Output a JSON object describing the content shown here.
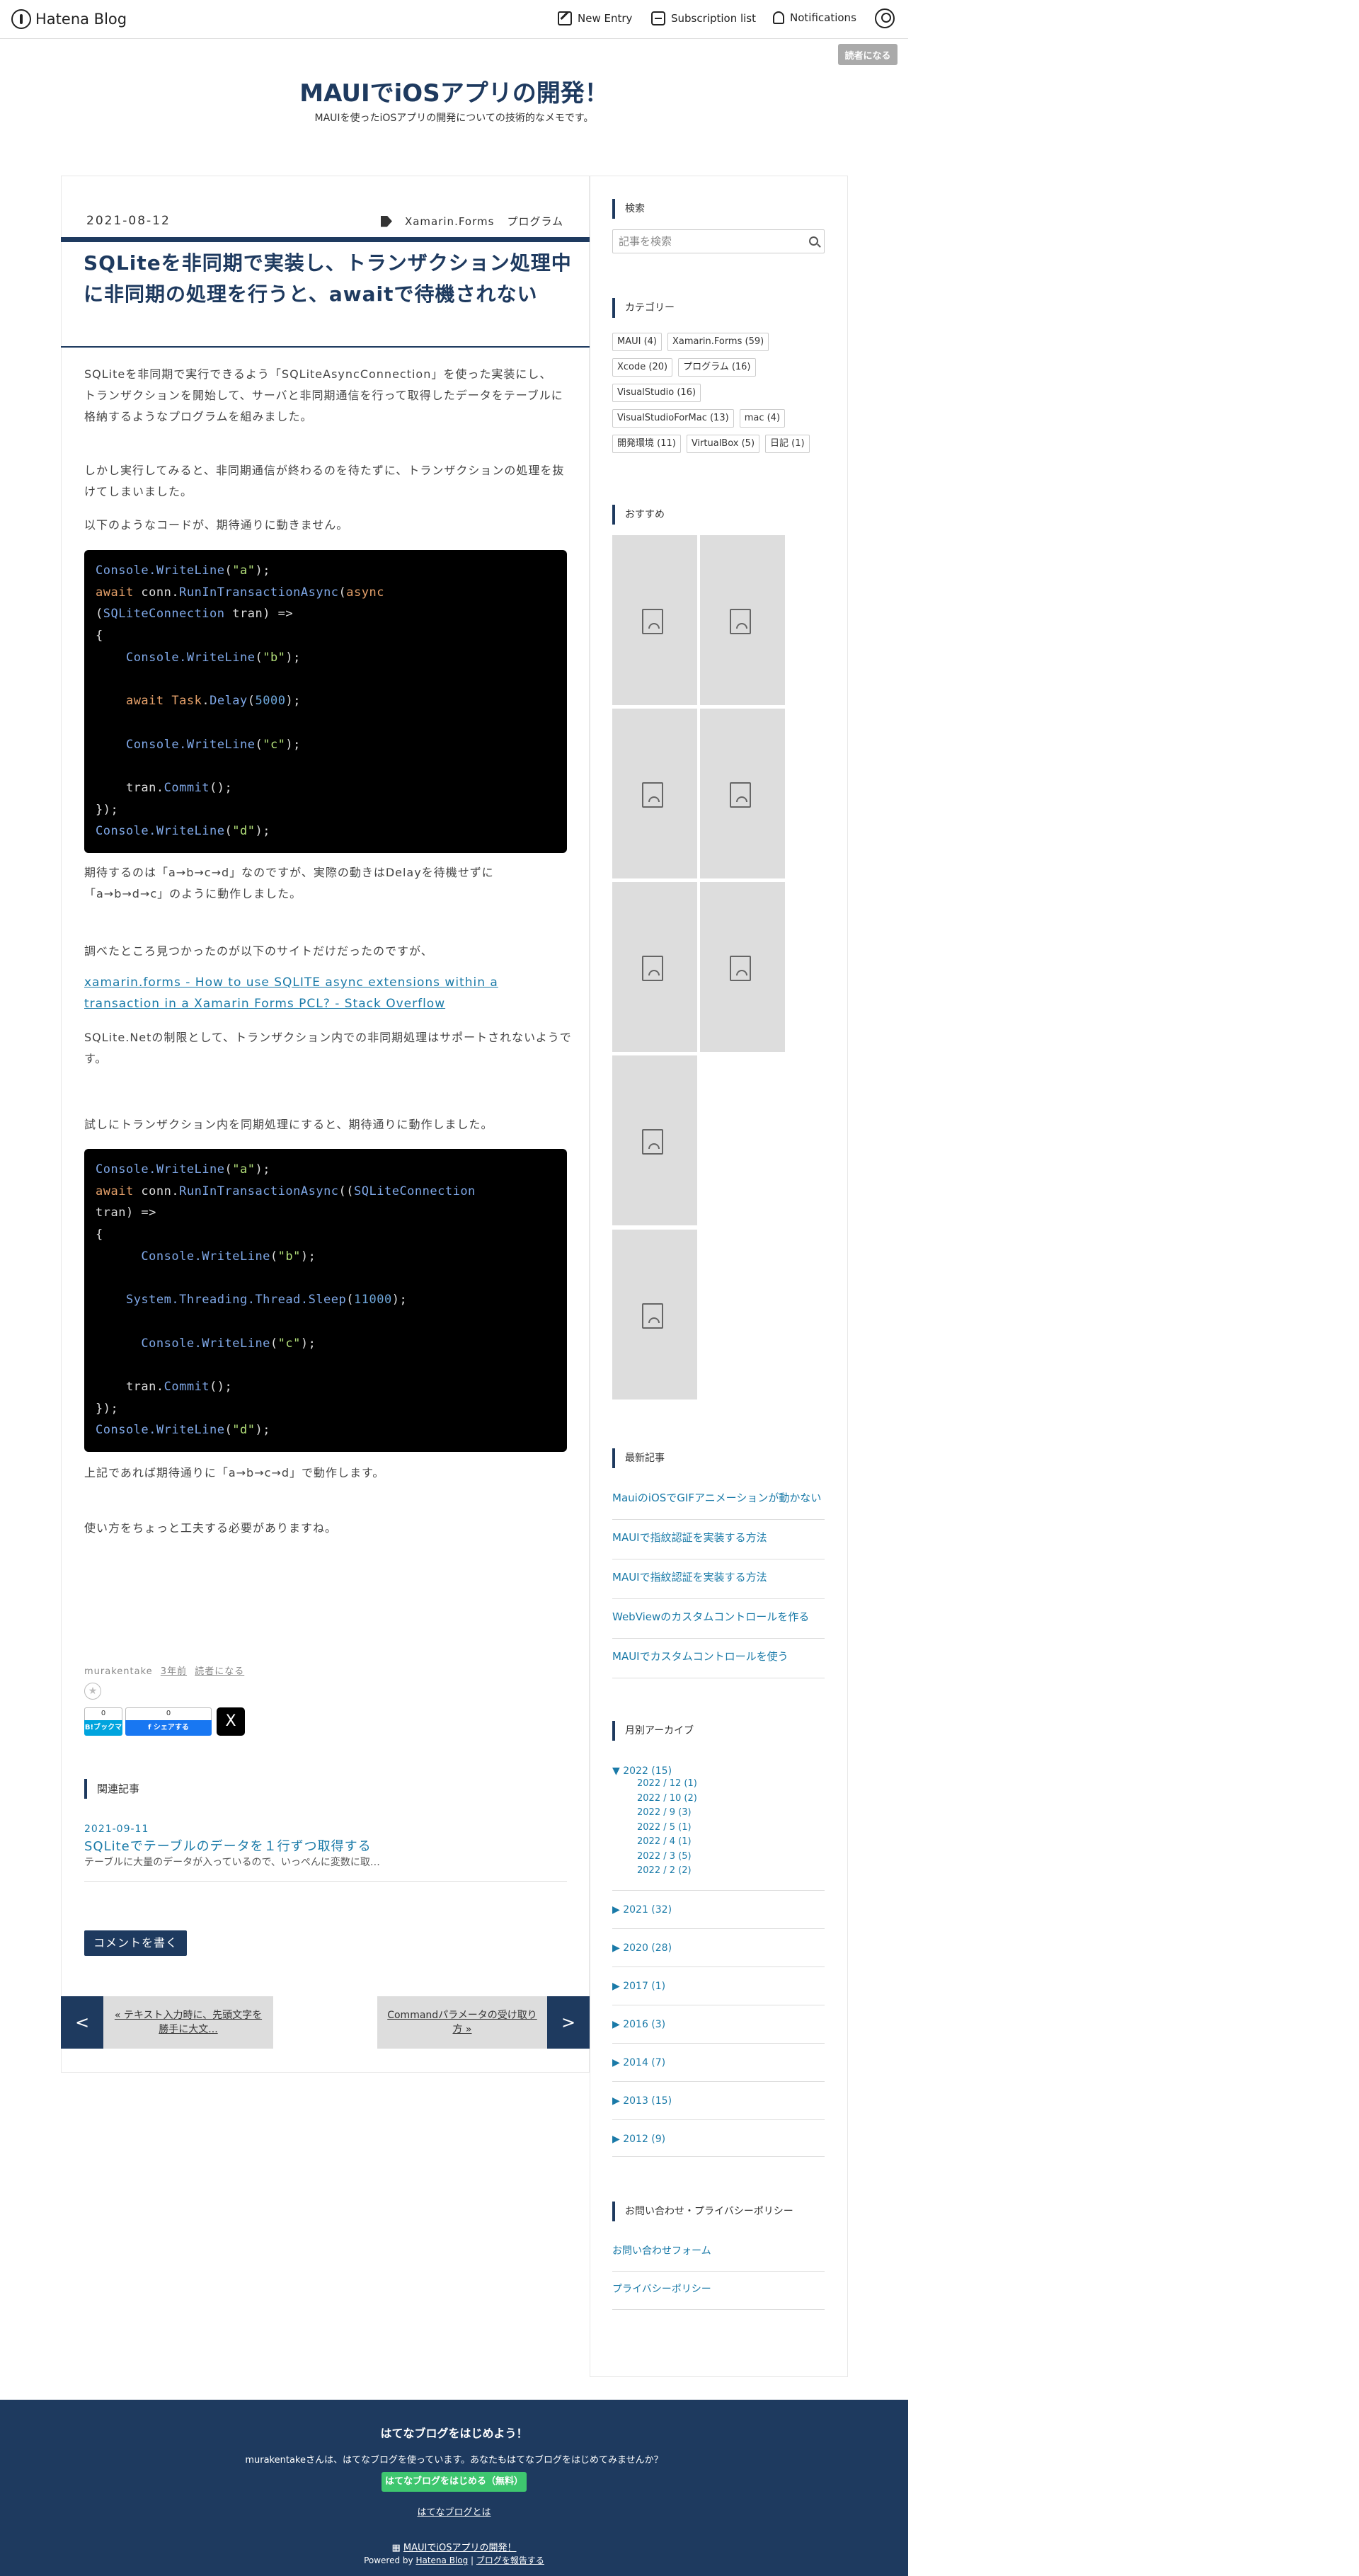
{
  "topbar": {
    "logo": "Hatena Blog",
    "new_entry": "New Entry",
    "subscription": "Subscription list",
    "notifications": "Notifications",
    "follow": "読者になる"
  },
  "blog": {
    "title": "MAUIでiOSアプリの開発！",
    "description": "MAUIを使ったiOSアプリの開発についての技術的なメモです。"
  },
  "entry": {
    "date": "2021-08-12",
    "categories": [
      "Xamarin.Forms",
      "プログラム"
    ],
    "title": "SQLiteを非同期で実装し、トランザクション処理中に非同期の処理を行うと、awaitで待機されない",
    "p1": [
      "SQLiteを非同期で実行できるよう「SQLiteAsyncConnection」を使った実装にし、",
      "トランザクションを開始して、サーバと非同期通信を行って取得したデータをテーブルに格納するようなプログラムを組みました。"
    ],
    "p2": "しかし実行してみると、非同期通信が終わるのを待たずに、トランザクションの処理を抜けてしまいました。",
    "p3": "以下のようなコードが、期待通りに動きません。",
    "p4a": "期待するのは「a→b→c→d」なのですが、実際の動きはDelayを待機せずに",
    "p4b": "「a→b→d→c」のように動作しました。",
    "p5": "調べたところ見つかったのが以下のサイトだけだったのですが、",
    "link": "xamarin.forms - How to use SQLITE async extensions within a transaction in a Xamarin Forms PCL? - Stack Overflow",
    "p6": "SQLite.Netの制限として、トランザクション内での非同期処理はサポートされないようです。",
    "p7": "試しにトランザクション内を同期処理にすると、期待通りに動作しました。",
    "p8": "上記であれば期待通りに「a→b→c→d」で動作します。",
    "p9": "使い方をちょっと工夫する必要がありますね。",
    "author": "murakentake",
    "age": "3年前",
    "follow": "読者になる",
    "hatebu_count": "0",
    "hatebu_label": "B!ブックマーク",
    "fb_count": "0",
    "fb_label": "f シェアする",
    "x_label": "X",
    "related_head": "関連記事",
    "related_date": "2021-09-11",
    "related_title": "SQLiteでテーブルのデータを１行ずつ取得する",
    "related_excerpt": "テーブルに大量のデータが入っているので、いっぺんに変数に取…",
    "comment": "コメントを書く",
    "prev_label": "« テキスト入力時に、先頭文字を勝手に大文...",
    "next_label": "Commandパラメータの受け取り方 »",
    "prev_arrow": "<",
    "next_arrow": ">"
  },
  "code1": [
    [
      [
        "f",
        "Console.WriteLine"
      ],
      [
        "t",
        "("
      ],
      [
        "s",
        "\"a\""
      ],
      [
        "t",
        ");"
      ]
    ],
    [
      [
        "k",
        "await"
      ],
      [
        "t",
        " conn."
      ],
      [
        "f",
        "RunInTransactionAsync"
      ],
      [
        "t",
        "("
      ],
      [
        "k",
        "async"
      ]
    ],
    [
      [
        "t",
        "("
      ],
      [
        "f",
        "SQLiteConnection"
      ],
      [
        "t",
        " tran) =>"
      ]
    ],
    [
      [
        "t",
        "{"
      ]
    ],
    [
      [
        "t",
        "    "
      ],
      [
        "f",
        "Console.WriteLine"
      ],
      [
        "t",
        "("
      ],
      [
        "s",
        "\"b\""
      ],
      [
        "t",
        ");"
      ]
    ],
    [
      [
        "t",
        ""
      ]
    ],
    [
      [
        "t",
        "    "
      ],
      [
        "k",
        "await"
      ],
      [
        "t",
        " "
      ],
      [
        "k",
        "Task"
      ],
      [
        "t",
        "."
      ],
      [
        "f",
        "Delay"
      ],
      [
        "t",
        "("
      ],
      [
        "n",
        "5000"
      ],
      [
        "t",
        ");"
      ]
    ],
    [
      [
        "t",
        ""
      ]
    ],
    [
      [
        "t",
        "    "
      ],
      [
        "f",
        "Console.WriteLine"
      ],
      [
        "t",
        "("
      ],
      [
        "s",
        "\"c\""
      ],
      [
        "t",
        ");"
      ]
    ],
    [
      [
        "t",
        ""
      ]
    ],
    [
      [
        "t",
        "    tran."
      ],
      [
        "f",
        "Commit"
      ],
      [
        "t",
        "();"
      ]
    ],
    [
      [
        "t",
        "});"
      ]
    ],
    [
      [
        "f",
        "Console.WriteLine"
      ],
      [
        "t",
        "("
      ],
      [
        "s",
        "\"d\""
      ],
      [
        "t",
        ");"
      ]
    ]
  ],
  "code2": [
    [
      [
        "f",
        "Console.WriteLine"
      ],
      [
        "t",
        "("
      ],
      [
        "s",
        "\"a\""
      ],
      [
        "t",
        ");"
      ]
    ],
    [
      [
        "k",
        "await"
      ],
      [
        "t",
        " conn."
      ],
      [
        "f",
        "RunInTransactionAsync"
      ],
      [
        "t",
        "(("
      ],
      [
        "f",
        "SQLiteConnection"
      ]
    ],
    [
      [
        "t",
        "tran) =>"
      ]
    ],
    [
      [
        "t",
        "{"
      ]
    ],
    [
      [
        "t",
        "      "
      ],
      [
        "f",
        "Console.WriteLine"
      ],
      [
        "t",
        "("
      ],
      [
        "s",
        "\"b\""
      ],
      [
        "t",
        ");"
      ]
    ],
    [
      [
        "t",
        ""
      ]
    ],
    [
      [
        "t",
        "    "
      ],
      [
        "f",
        "System.Threading.Thread.Sleep"
      ],
      [
        "t",
        "("
      ],
      [
        "n",
        "11000"
      ],
      [
        "t",
        ");"
      ]
    ],
    [
      [
        "t",
        ""
      ]
    ],
    [
      [
        "t",
        "      "
      ],
      [
        "f",
        "Console.WriteLine"
      ],
      [
        "t",
        "("
      ],
      [
        "s",
        "\"c\""
      ],
      [
        "t",
        ");"
      ]
    ],
    [
      [
        "t",
        ""
      ]
    ],
    [
      [
        "t",
        "    tran."
      ],
      [
        "f",
        "Commit"
      ],
      [
        "t",
        "();"
      ]
    ],
    [
      [
        "t",
        "});"
      ]
    ],
    [
      [
        "f",
        "Console.WriteLine"
      ],
      [
        "t",
        "("
      ],
      [
        "s",
        "\"d\""
      ],
      [
        "t",
        ");"
      ]
    ]
  ],
  "sidebar": {
    "search_head": "検索",
    "search_placeholder": "記事を検索",
    "cat_head": "カテゴリー",
    "categories": [
      "MAUI (4)",
      "Xamarin.Forms (59)",
      "Xcode (20)",
      "プログラム (16)",
      "VisualStudio (16)",
      "VisualStudioForMac (13)",
      "mac (4)",
      "開発環境 (11)",
      "VirtualBox (5)",
      "日記 (1)"
    ],
    "rec_head": "おすすめ",
    "latest_head": "最新記事",
    "latest": [
      "MauiのiOSでGIFアニメーションが動かない",
      "MAUIで指紋認証を実装する方法",
      "MAUIで指紋認証を実装する方法",
      "WebViewのカスタムコントロールを作る",
      "MAUIでカスタムコントロールを使う"
    ],
    "archive_head": "月別アーカイブ",
    "archive_open": "▼ 2022 (15)",
    "archive_months": [
      "2022 / 12 (1)",
      "2022 / 10 (2)",
      "2022 / 9 (3)",
      "2022 / 5 (1)",
      "2022 / 4 (1)",
      "2022 / 3 (5)",
      "2022 / 2 (2)"
    ],
    "archive_years": [
      "▶ 2021 (32)",
      "▶ 2020 (28)",
      "▶ 2017 (1)",
      "▶ 2016 (3)",
      "▶ 2014 (7)",
      "▶ 2013 (15)",
      "▶ 2012 (9)"
    ],
    "contact_head": "お問い合わせ・プライバシーポリシー",
    "contact": [
      "お問い合わせフォーム",
      "プライバシーポリシー"
    ]
  },
  "footer": {
    "title": "はてなブログをはじめよう！",
    "text": "murakentakeさんは、はてなブログを使っています。あなたもはてなブログをはじめてみませんか？",
    "button": "はてなブログをはじめる（無料）",
    "about": "はてなブログとは",
    "blog_name": "MAUIでiOSアプリの開発！",
    "powered": "Powered by",
    "hatena_blog": "Hatena Blog",
    "sep": "|",
    "report": "ブログを報告する"
  },
  "colors": {
    "accent": "#1e3a5f",
    "link": "#1a7aa8",
    "green": "#3ec66f"
  }
}
